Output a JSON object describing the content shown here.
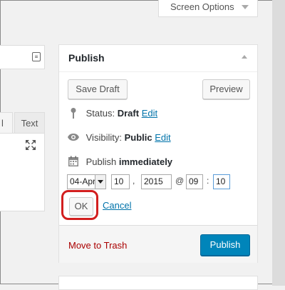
{
  "screen_options": {
    "label": "Screen Options"
  },
  "editor": {
    "tab_visual_fragment": "l",
    "tab_text": "Text"
  },
  "publish": {
    "title": "Publish",
    "save_draft": "Save Draft",
    "preview": "Preview",
    "status_label": "Status:",
    "status_value": "Draft",
    "status_edit": "Edit",
    "visibility_label": "Visibility:",
    "visibility_value": "Public",
    "visibility_edit": "Edit",
    "publish_label": "Publish",
    "publish_value": "immediately",
    "date": {
      "month": "04-Apr",
      "day": "10",
      "sep_comma": ",",
      "year": "2015",
      "sep_at": "@",
      "hour": "09",
      "sep_colon": ":",
      "minute": "10"
    },
    "ok": "OK",
    "cancel": "Cancel",
    "move_to_trash": "Move to Trash",
    "publish_button": "Publish"
  },
  "colors": {
    "accent": "#0085ba",
    "link": "#0073aa",
    "trash": "#a00000",
    "highlight": "#d21e1e"
  }
}
